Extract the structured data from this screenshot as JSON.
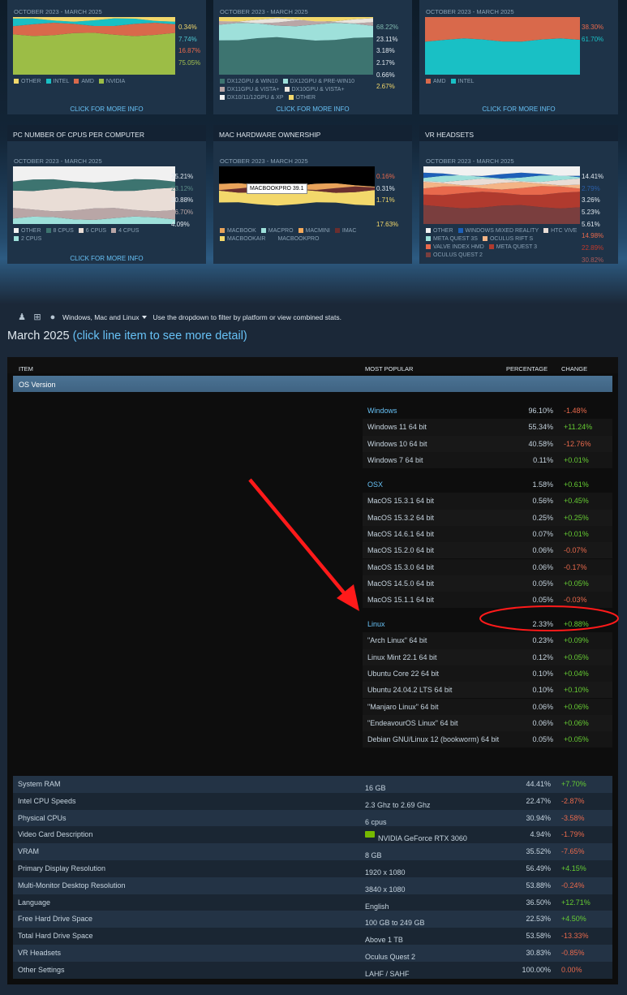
{
  "cards": [
    {
      "title": "",
      "daterange": "OCTOBER 2023 - MARCH 2025",
      "pcts": [
        {
          "v": "0.34%",
          "c": "#f3d86b"
        },
        {
          "v": "7.74%",
          "c": "#4dc9d2"
        },
        {
          "v": "16.87%",
          "c": "#e8694c"
        },
        {
          "v": "75.05%",
          "c": "#a5c24f"
        }
      ],
      "legend": [
        {
          "label": "OTHER",
          "color": "#f3d86b"
        },
        {
          "label": "INTEL",
          "color": "#19c0c5"
        },
        {
          "label": "AMD",
          "color": "#d9694b"
        },
        {
          "label": "NVIDIA",
          "color": "#9cbd46"
        }
      ],
      "more": "CLICK FOR MORE INFO"
    },
    {
      "title": "",
      "daterange": "OCTOBER 2023 - MARCH 2025",
      "pcts": [
        {
          "v": "68.22%",
          "c": "#7fb7ae"
        },
        {
          "v": "23.11%",
          "c": "#dfe7ee"
        },
        {
          "v": "3.18%",
          "c": "#dfe7ee"
        },
        {
          "v": "2.17%",
          "c": "#dfe7ee"
        },
        {
          "v": "0.66%",
          "c": "#dfe7ee"
        },
        {
          "v": "2.67%",
          "c": "#f3d86b"
        }
      ],
      "legend": [
        {
          "label": "DX12GPU & WIN10",
          "color": "#3d7470"
        },
        {
          "label": "DX12GPU & PRE-WIN10",
          "color": "#9ee0da"
        },
        {
          "label": "DX11GPU & VISTA+",
          "color": "#b9a6a6"
        },
        {
          "label": "DX10GPU & VISTA+",
          "color": "#e9e4dd"
        },
        {
          "label": "DX10/11/12GPU & XP",
          "color": "#f1f1f1"
        },
        {
          "label": "OTHER",
          "color": "#f3d86b"
        }
      ],
      "more": "CLICK FOR MORE INFO"
    },
    {
      "title": "",
      "daterange": "OCTOBER 2023 - MARCH 2025",
      "pcts": [
        {
          "v": "38.30%",
          "c": "#e8694c"
        },
        {
          "v": "61.70%",
          "c": "#19c0c5"
        }
      ],
      "legend": [
        {
          "label": "AMD",
          "color": "#d9694b"
        },
        {
          "label": "INTEL",
          "color": "#19c0c5"
        }
      ],
      "more": "CLICK FOR MORE INFO"
    },
    {
      "title": "PC NUMBER OF CPUS PER COMPUTER",
      "daterange": "OCTOBER 2023 - MARCH 2025",
      "pcts": [
        {
          "v": "25.21%",
          "c": "#dfe7ee"
        },
        {
          "v": "23.12%",
          "c": "#5a8a86"
        },
        {
          "v": "30.88%",
          "c": "#dfe7ee"
        },
        {
          "v": "16.70%",
          "c": "#b9a6a6"
        },
        {
          "v": "4.09%",
          "c": "#dfe7ee"
        }
      ],
      "legend": [
        {
          "label": "OTHER",
          "color": "#f1f1f1"
        },
        {
          "label": "8 CPUS",
          "color": "#3d7470"
        },
        {
          "label": "6 CPUS",
          "color": "#e9ddd6"
        },
        {
          "label": "4 CPUS",
          "color": "#b9a6a6"
        },
        {
          "label": "2 CPUS",
          "color": "#9ee0da"
        }
      ],
      "more": "CLICK FOR MORE INFO"
    },
    {
      "title": "MAC HARDWARE OWNERSHIP",
      "daterange": "OCTOBER 2023 - MARCH 2025",
      "pcts": [
        {
          "v": "0.16%",
          "c": "#e8694c"
        },
        {
          "v": "0.31%",
          "c": "#dfe7ee"
        },
        {
          "v": "1.71%",
          "c": "#f3d86b"
        },
        {
          "v": "",
          "c": "#dfe7ee"
        },
        {
          "v": "17.63%",
          "c": "#f3d86b"
        }
      ],
      "legend": [
        {
          "label": "MACBOOK",
          "color": "#e8a35a"
        },
        {
          "label": "MACPRO",
          "color": "#9ee0da"
        },
        {
          "label": "MACMINI",
          "color": "#f4a95a"
        },
        {
          "label": "IMAC",
          "color": "#6b2e2e"
        },
        {
          "label": "MACBOOKAIR",
          "color": "#f3d86b"
        },
        {
          "label": "MACBOOKPRO",
          "color": "#1e3348"
        }
      ],
      "tooltip": "MACBOOKPRO 39.1",
      "more": ""
    },
    {
      "title": "VR HEADSETS",
      "daterange": "OCTOBER 2023 - MARCH 2025",
      "pcts": [
        {
          "v": "14.41%",
          "c": "#dfe7ee"
        },
        {
          "v": "2.79%",
          "c": "#2a5ea8"
        },
        {
          "v": "3.26%",
          "c": "#dfe7ee"
        },
        {
          "v": "5.23%",
          "c": "#dfe7ee"
        },
        {
          "v": "5.61%",
          "c": "#dfe7ee"
        },
        {
          "v": "14.98%",
          "c": "#e8694c"
        },
        {
          "v": "22.89%",
          "c": "#c0392b"
        },
        {
          "v": "30.82%",
          "c": "#a85a5a"
        }
      ],
      "legend": [
        {
          "label": "OTHER",
          "color": "#f1f1f1"
        },
        {
          "label": "WINDOWS MIXED REALITY",
          "color": "#1d5fb8"
        },
        {
          "label": "HTC VIVE",
          "color": "#e9ddd6"
        },
        {
          "label": "META QUEST 3S",
          "color": "#9ee0da"
        },
        {
          "label": "OCULUS RIFT S",
          "color": "#f4b486"
        },
        {
          "label": "VALVE INDEX HMD",
          "color": "#e8694c"
        },
        {
          "label": "META QUEST 3",
          "color": "#b03a2e"
        },
        {
          "label": "OCULUS QUEST 2",
          "color": "#7a3e3e"
        }
      ],
      "more": ""
    }
  ],
  "filter": {
    "label": "Windows, Mac and Linux",
    "hint": "Use the dropdown to filter by platform or view combined stats."
  },
  "month": {
    "title": "March 2025",
    "sub": "(click line item to see more detail)"
  },
  "columns": {
    "item": "ITEM",
    "popular": "MOST POPULAR",
    "percentage": "PERCENTAGE",
    "change": "CHANGE"
  },
  "os_section": "OS Version",
  "os_rows": [
    {
      "name": "Windows",
      "pct": "96.10%",
      "chg": "-1.48%",
      "plat": true
    },
    {
      "name": "Windows 11 64 bit",
      "pct": "55.34%",
      "chg": "+11.24%"
    },
    {
      "name": "Windows 10 64 bit",
      "pct": "40.58%",
      "chg": "-12.76%"
    },
    {
      "name": "Windows 7 64 bit",
      "pct": "0.11%",
      "chg": "+0.01%"
    },
    {
      "name": "OSX",
      "pct": "1.58%",
      "chg": "+0.61%",
      "plat": true
    },
    {
      "name": "MacOS 15.3.1 64 bit",
      "pct": "0.56%",
      "chg": "+0.45%"
    },
    {
      "name": "MacOS 15.3.2 64 bit",
      "pct": "0.25%",
      "chg": "+0.25%"
    },
    {
      "name": "MacOS 14.6.1 64 bit",
      "pct": "0.07%",
      "chg": "+0.01%"
    },
    {
      "name": "MacOS 15.2.0 64 bit",
      "pct": "0.06%",
      "chg": "-0.07%"
    },
    {
      "name": "MacOS 15.3.0 64 bit",
      "pct": "0.06%",
      "chg": "-0.17%"
    },
    {
      "name": "MacOS 14.5.0 64 bit",
      "pct": "0.05%",
      "chg": "+0.05%"
    },
    {
      "name": "MacOS 15.1.1 64 bit",
      "pct": "0.05%",
      "chg": "-0.03%"
    },
    {
      "name": "Linux",
      "pct": "2.33%",
      "chg": "+0.88%",
      "plat": true
    },
    {
      "name": "\"Arch Linux\" 64 bit",
      "pct": "0.23%",
      "chg": "+0.09%"
    },
    {
      "name": "Linux Mint 22.1 64 bit",
      "pct": "0.12%",
      "chg": "+0.05%"
    },
    {
      "name": "Ubuntu Core 22 64 bit",
      "pct": "0.10%",
      "chg": "+0.04%"
    },
    {
      "name": "Ubuntu 24.04.2 LTS 64 bit",
      "pct": "0.10%",
      "chg": "+0.10%"
    },
    {
      "name": "\"Manjaro Linux\" 64 bit",
      "pct": "0.06%",
      "chg": "+0.06%"
    },
    {
      "name": "\"EndeavourOS Linux\" 64 bit",
      "pct": "0.06%",
      "chg": "+0.06%"
    },
    {
      "name": "Debian GNU/Linux 12 (bookworm) 64 bit",
      "pct": "0.05%",
      "chg": "+0.05%"
    }
  ],
  "other_rows": [
    {
      "item": "System RAM",
      "popular": "16 GB",
      "pct": "44.41%",
      "chg": "+7.70%"
    },
    {
      "item": "Intel CPU Speeds",
      "popular": "2.3 Ghz to 2.69 Ghz",
      "pct": "22.47%",
      "chg": "-2.87%"
    },
    {
      "item": "Physical CPUs",
      "popular": "6 cpus",
      "pct": "30.94%",
      "chg": "-3.58%"
    },
    {
      "item": "Video Card Description",
      "popular": "NVIDIA GeForce RTX 3060",
      "pct": "4.94%",
      "chg": "-1.79%",
      "icon": true
    },
    {
      "item": "VRAM",
      "popular": "8 GB",
      "pct": "35.52%",
      "chg": "-7.65%"
    },
    {
      "item": "Primary Display Resolution",
      "popular": "1920 x 1080",
      "pct": "56.49%",
      "chg": "+4.15%"
    },
    {
      "item": "Multi-Monitor Desktop Resolution",
      "popular": "3840 x 1080",
      "pct": "53.88%",
      "chg": "-0.24%"
    },
    {
      "item": "Language",
      "popular": "English",
      "pct": "36.50%",
      "chg": "+12.71%"
    },
    {
      "item": "Free Hard Drive Space",
      "popular": "100 GB to 249 GB",
      "pct": "22.53%",
      "chg": "+4.50%"
    },
    {
      "item": "Total Hard Drive Space",
      "popular": "Above 1 TB",
      "pct": "53.58%",
      "chg": "-13.33%"
    },
    {
      "item": "VR Headsets",
      "popular": "Oculus Quest 2",
      "pct": "30.83%",
      "chg": "-0.85%"
    },
    {
      "item": "Other Settings",
      "popular": "LAHF / SAHF",
      "pct": "100.00%",
      "chg": "0.00%"
    }
  ],
  "colors": {
    "positive": "#66cc33",
    "negative": "#e8694c",
    "link": "#67c1f5",
    "annotation": "#ff1a1a"
  }
}
